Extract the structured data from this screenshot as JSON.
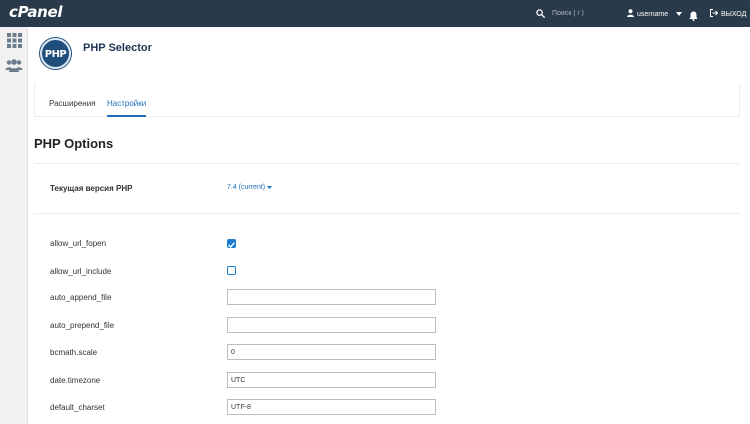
{
  "topbar": {
    "logo": "cPanel",
    "search_placeholder": "Поиск ( / )",
    "username": "username",
    "logout_label": "ВЫХОД"
  },
  "sidebar": {
    "items": [
      {
        "icon": "apps-grid-icon"
      },
      {
        "icon": "users-icon"
      }
    ]
  },
  "header": {
    "logo_text": "PHP",
    "title": "PHP Selector"
  },
  "tabs": [
    {
      "label": "Расширения",
      "active": false
    },
    {
      "label": "Настройки",
      "active": true
    }
  ],
  "main": {
    "section_title": "PHP Options",
    "version_label": "Текущая версия PHP",
    "version_value": "7.4 (current)",
    "options": [
      {
        "name": "allow_url_fopen",
        "type": "checkbox",
        "checked": true
      },
      {
        "name": "allow_url_include",
        "type": "checkbox",
        "checked": false
      },
      {
        "name": "auto_append_file",
        "type": "text",
        "value": ""
      },
      {
        "name": "auto_prepend_file",
        "type": "text",
        "value": ""
      },
      {
        "name": "bcmath.scale",
        "type": "text",
        "value": "0"
      },
      {
        "name": "date.timezone",
        "type": "text",
        "value": "UTC"
      },
      {
        "name": "default_charset",
        "type": "text",
        "value": "UTF-8"
      }
    ]
  },
  "colors": {
    "topbar_bg": "#293a4a",
    "accent": "#1d6fb8",
    "checkbox": "#1d7fd1",
    "title": "#1d3554"
  }
}
